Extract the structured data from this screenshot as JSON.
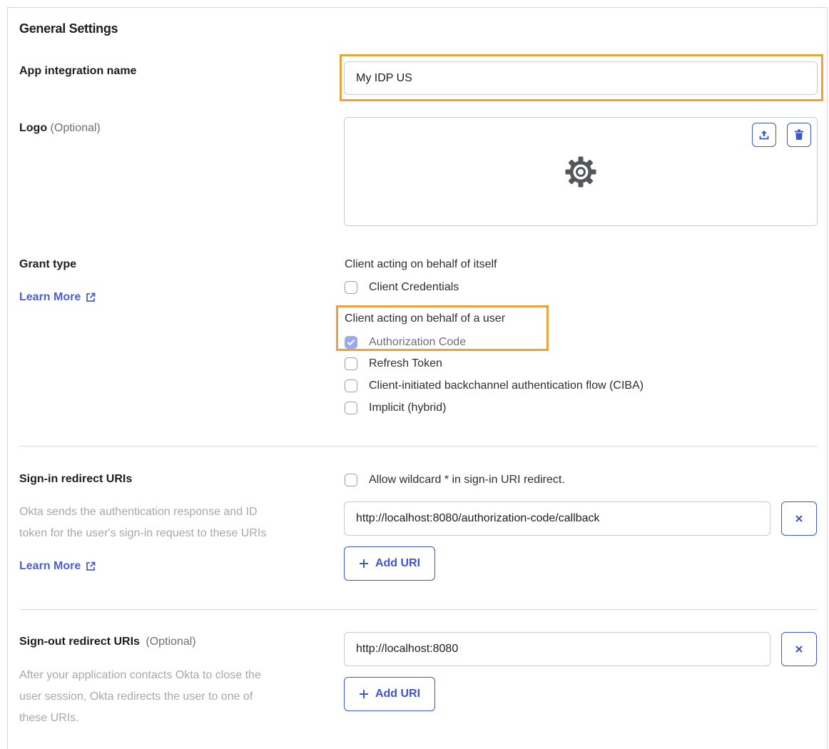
{
  "section": {
    "title": "General Settings"
  },
  "app_name": {
    "label": "App integration name",
    "value": "My IDP US"
  },
  "logo": {
    "label": "Logo",
    "optional": "(Optional)",
    "placeholder_icon": "gear-icon"
  },
  "grant_type": {
    "label": "Grant type",
    "learn_more": "Learn More",
    "group_itself": "Client acting on behalf of itself",
    "group_user": "Client acting on behalf of a user",
    "options": {
      "client_credentials": {
        "label": "Client Credentials",
        "checked": false
      },
      "authorization_code": {
        "label": "Authorization Code",
        "checked": true
      },
      "refresh_token": {
        "label": "Refresh Token",
        "checked": false
      },
      "ciba": {
        "label": "Client-initiated backchannel authentication flow (CIBA)",
        "checked": false
      },
      "implicit": {
        "label": "Implicit (hybrid)",
        "checked": false
      }
    }
  },
  "signin": {
    "label": "Sign-in redirect URIs",
    "description_line1": "Okta sends the authentication response and ID",
    "description_line2": "token for the user's sign-in request to these URIs",
    "learn_more": "Learn More",
    "wildcard_label": "Allow wildcard * in sign-in URI redirect.",
    "uri_value": "http://localhost:8080/authorization-code/callback",
    "add_label": "Add URI"
  },
  "signout": {
    "label": "Sign-out redirect URIs",
    "optional": "(Optional)",
    "description_line1": "After your application contacts Okta to close the",
    "description_line2": "user session, Okta redirects the user to one of",
    "description_line3": "these URIs.",
    "uri_value": "http://localhost:8080",
    "add_label": "Add URI"
  },
  "colors": {
    "accent": "#3d55c9",
    "highlight": "#e8a33b",
    "link": "#4b5fcf"
  }
}
